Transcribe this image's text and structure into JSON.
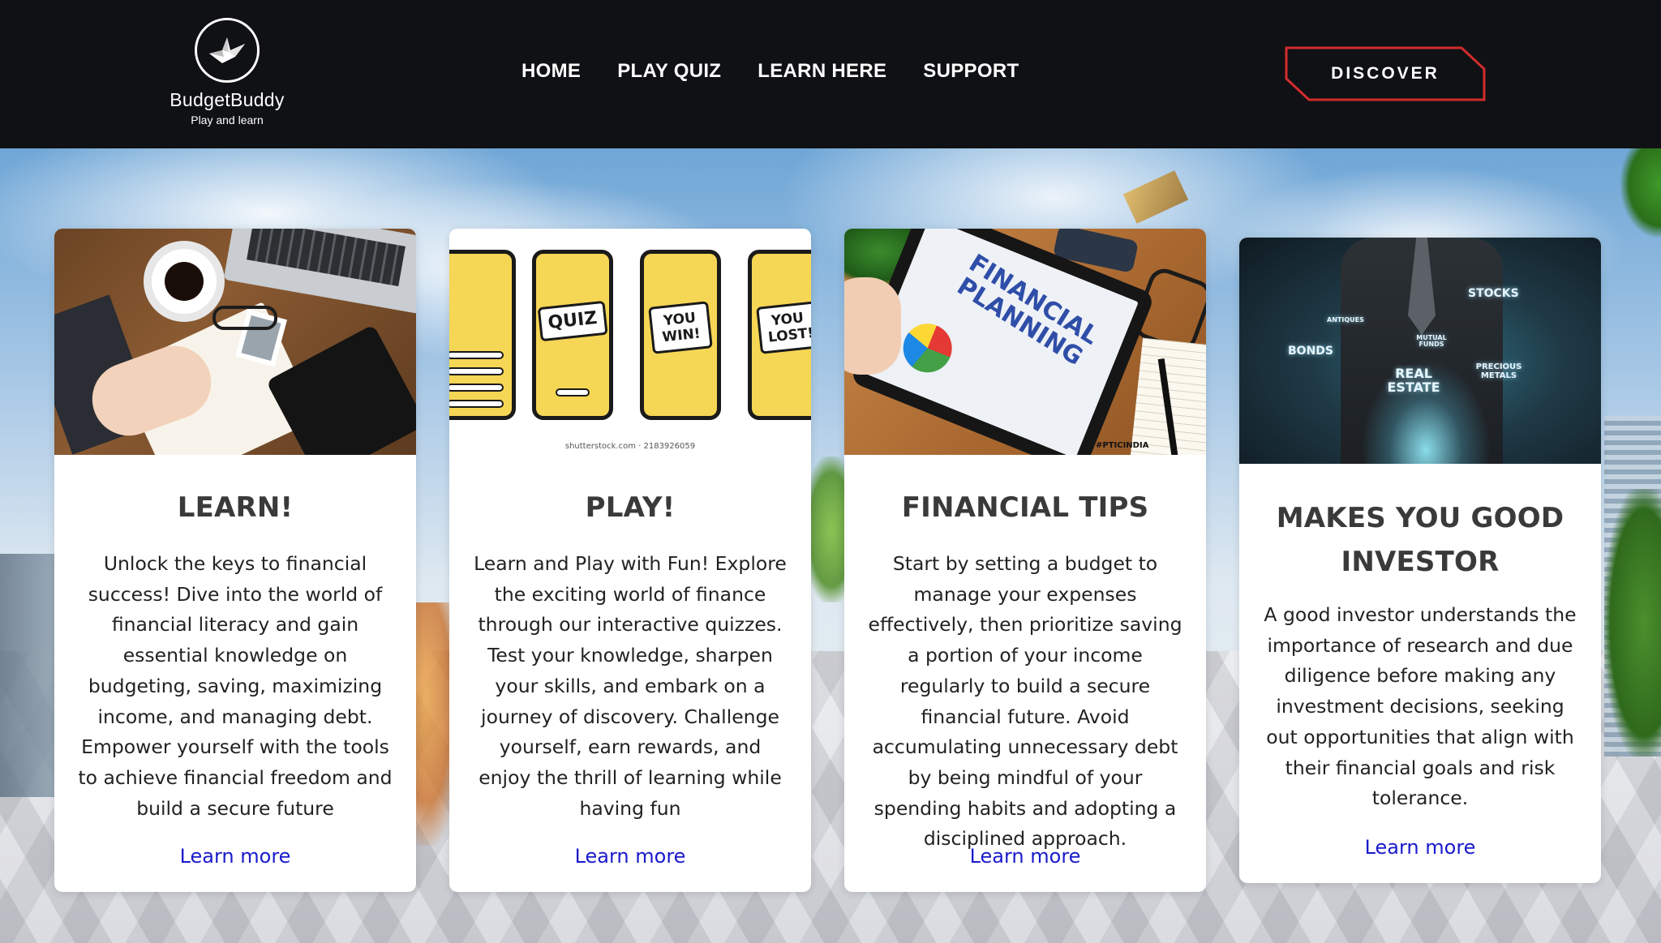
{
  "header": {
    "brand_name": "BudgetBuddy",
    "brand_tagline": "Play and learn",
    "nav": [
      "HOME",
      "PLAY QUIZ",
      "LEARN HERE",
      "SUPPORT"
    ],
    "cta_label": "DISCOVER"
  },
  "colors": {
    "header_bg": "#101114",
    "cta_border": "#d22c2c",
    "link": "#1a1acc",
    "heading": "#3a3a3a"
  },
  "cards": [
    {
      "title": "LEARN!",
      "body": "Unlock the keys to financial success! Dive into the world of financial literacy and gain essential knowledge on budgeting, saving, maximizing income, and managing debt. Empower yourself with the tools to achieve financial freedom and build a secure future",
      "link": "Learn more"
    },
    {
      "title": "PLAY!",
      "body": "Learn and Play with Fun! Explore the exciting world of finance through our interactive quizzes. Test your knowledge, sharpen your skills, and embark on a journey of discovery. Challenge yourself, earn rewards, and enjoy the thrill of learning while having fun",
      "link": "Learn more",
      "image_text": {
        "phone_quiz": "QUIZ",
        "phone_win": "YOU WIN!",
        "phone_lost": "YOU LOST!",
        "credit": "shutterstock.com · 2183926059"
      }
    },
    {
      "title": "FINANCIAL TIPS",
      "body": "Start by setting a budget to manage your expenses effectively, then prioritize saving a portion of your income regularly to build a secure financial future. Avoid accumulating unnecessary debt by being mindful of your spending habits and adopting a disciplined approach.",
      "link": "Learn more",
      "image_text": {
        "screen_title": "FINANCIAL PLANNING",
        "hashtag": "#PTICINDIA"
      }
    },
    {
      "title": "MAKES YOU GOOD INVESTOR",
      "body": "A good investor understands the importance of research and due diligence before making any investment decisions, seeking out opportunities that align with their financial goals and risk tolerance.",
      "link": "Learn more",
      "image_text": {
        "stocks": "STOCKS",
        "bonds": "BONDS",
        "antiques": "ANTIQUES",
        "mutual_funds": "MUTUAL FUNDS",
        "real_estate": "REAL ESTATE",
        "precious_metals": "PRECIOUS METALS"
      }
    }
  ]
}
